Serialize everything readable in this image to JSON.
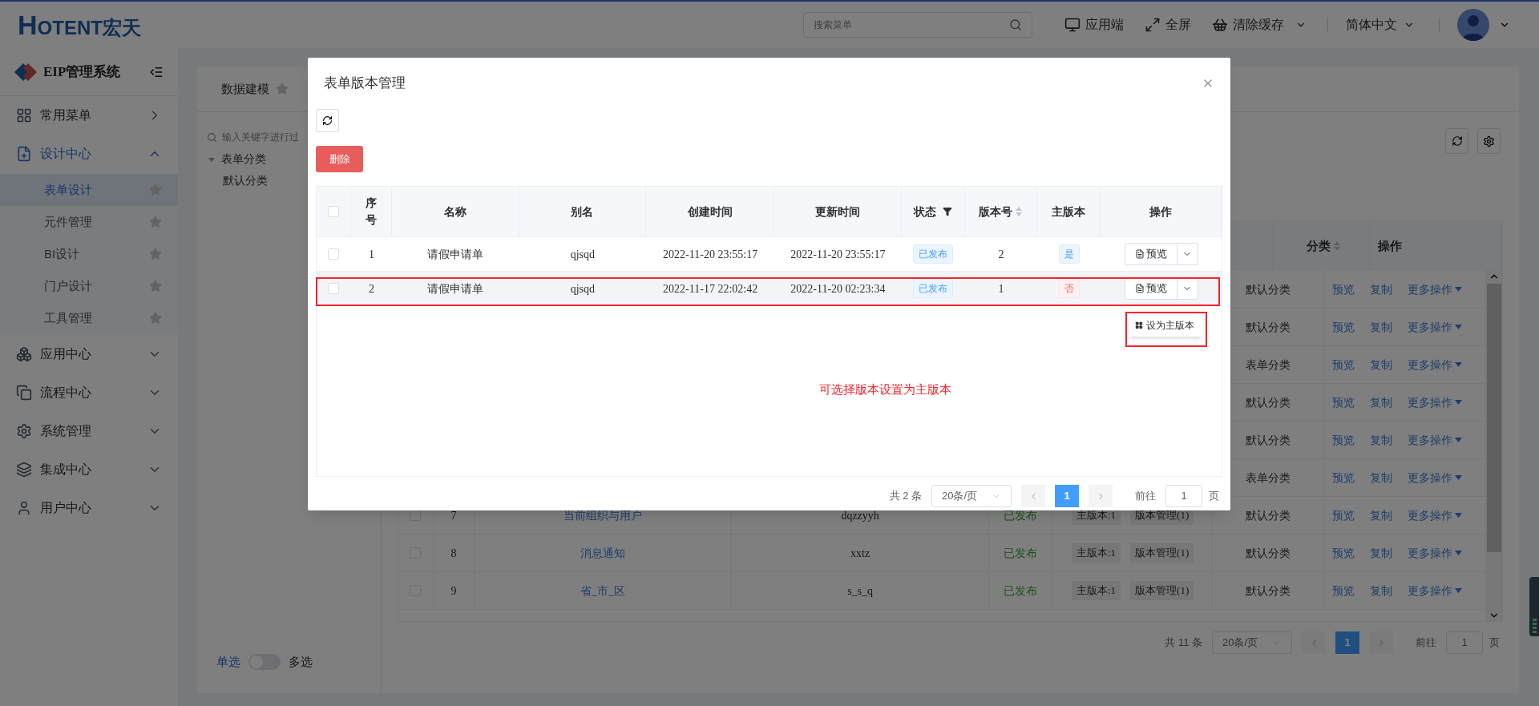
{
  "header": {
    "logo_mark": "H",
    "logo_text": "OTENT宏天",
    "search": {
      "placeholder": "搜索菜单"
    },
    "actions": [
      {
        "label": "应用端",
        "caret": false
      },
      {
        "label": "全屏",
        "caret": false
      },
      {
        "label": "清除缓存",
        "caret": true
      }
    ],
    "language": "简体中文"
  },
  "sidebar": {
    "title": "EIP管理系统",
    "items": [
      {
        "label": "常用菜单",
        "kind": "link"
      },
      {
        "label": "设计中心",
        "kind": "group",
        "expanded": true,
        "children": [
          {
            "label": "表单设计",
            "selected": true
          },
          {
            "label": "元件管理",
            "selected": false
          },
          {
            "label": "BI设计",
            "selected": false
          },
          {
            "label": "门户设计",
            "selected": false
          },
          {
            "label": "工具管理",
            "selected": false
          }
        ]
      },
      {
        "label": "应用中心",
        "kind": "group",
        "expanded": false
      },
      {
        "label": "流程中心",
        "kind": "group",
        "expanded": false
      },
      {
        "label": "系统管理",
        "kind": "group",
        "expanded": false
      },
      {
        "label": "集成中心",
        "kind": "group",
        "expanded": false
      },
      {
        "label": "用户中心",
        "kind": "group",
        "expanded": false
      }
    ]
  },
  "content": {
    "tabs": [
      {
        "label": "数据建模",
        "selected": true
      }
    ],
    "tree": {
      "placeholder": "输入关键字进行过",
      "nodes": [
        {
          "label": "表单分类",
          "expanded": true,
          "children": [
            {
              "label": "默认分类"
            }
          ]
        }
      ]
    },
    "select_mode": {
      "single": "单选",
      "multi": "多选",
      "on": false
    },
    "table": {
      "columns": [
        {
          "label": "分类",
          "sortable": true
        },
        {
          "label": "操作",
          "sortable": false
        }
      ],
      "rows": [
        {
          "category": "默认分类",
          "actions": [
            "预览",
            "复制",
            "更多操作"
          ]
        },
        {
          "category": "默认分类",
          "actions": [
            "预览",
            "复制",
            "更多操作"
          ]
        },
        {
          "category": "表单分类",
          "actions": [
            "预览",
            "复制",
            "更多操作"
          ]
        },
        {
          "category": "默认分类",
          "actions": [
            "预览",
            "复制",
            "更多操作"
          ]
        },
        {
          "category": "默认分类",
          "actions": [
            "预览",
            "复制",
            "更多操作"
          ]
        },
        {
          "category": "表单分类",
          "actions": [
            "预览",
            "复制",
            "更多操作"
          ]
        },
        {
          "checked": false,
          "index": "7",
          "name": "当前组织与用户",
          "alias": "dqzzyyh",
          "status": "已发布",
          "main_version": "主版本:1",
          "versions": "版本管理(1)",
          "category": "默认分类",
          "actions": [
            "预览",
            "复制",
            "更多操作"
          ]
        },
        {
          "checked": false,
          "index": "8",
          "name": "消息通知",
          "alias": "xxtz",
          "status": "已发布",
          "main_version": "主版本:1",
          "versions": "版本管理(1)",
          "category": "默认分类",
          "actions": [
            "预览",
            "复制",
            "更多操作"
          ]
        },
        {
          "checked": false,
          "index": "9",
          "name": "省_市_区",
          "alias": "s_s_q",
          "status": "已发布",
          "main_version": "主版本:1",
          "versions": "版本管理(1)",
          "category": "默认分类",
          "actions": [
            "预览",
            "复制",
            "更多操作"
          ]
        }
      ]
    },
    "pagination": {
      "total": "共 11 条",
      "page_size": "20条/页",
      "pages": [
        {
          "label": "1",
          "selected": true
        }
      ],
      "goto": "前往",
      "page": "1",
      "unit": "页"
    }
  },
  "modal": {
    "title": "表单版本管理",
    "delete": "删除",
    "select_all": false,
    "columns": [
      {
        "label": "序号"
      },
      {
        "label": "名称"
      },
      {
        "label": "别名"
      },
      {
        "label": "创建时间"
      },
      {
        "label": "更新时间"
      },
      {
        "label": "状态",
        "filter": true
      },
      {
        "label": "版本号",
        "sortable": true
      },
      {
        "label": "主版本"
      },
      {
        "label": "操作"
      }
    ],
    "rows": [
      {
        "checked": false,
        "hovered": false,
        "index": "1",
        "name": "请假申请单",
        "alias": "qjsqd",
        "created": "2022-11-20 23:55:17",
        "updated": "2022-11-20 23:55:17",
        "status": "已发布",
        "version": "2",
        "main": true,
        "main_label": "是",
        "action": "预览"
      },
      {
        "checked": false,
        "hovered": true,
        "index": "2",
        "name": "请假申请单",
        "alias": "qjsqd",
        "created": "2022-11-17 22:02:42",
        "updated": "2022-11-20 02:23:34",
        "status": "已发布",
        "version": "1",
        "main": false,
        "main_label": "否",
        "action": "预览"
      }
    ],
    "menu": [
      {
        "label": "设为主版本"
      }
    ],
    "annotation": "可选择版本设置为主版本",
    "pagination": {
      "total": "共 2 条",
      "page_size": "20条/页",
      "pages": [
        {
          "label": "1",
          "selected": true
        }
      ],
      "goto": "前往",
      "page": "1",
      "unit": "页"
    }
  }
}
